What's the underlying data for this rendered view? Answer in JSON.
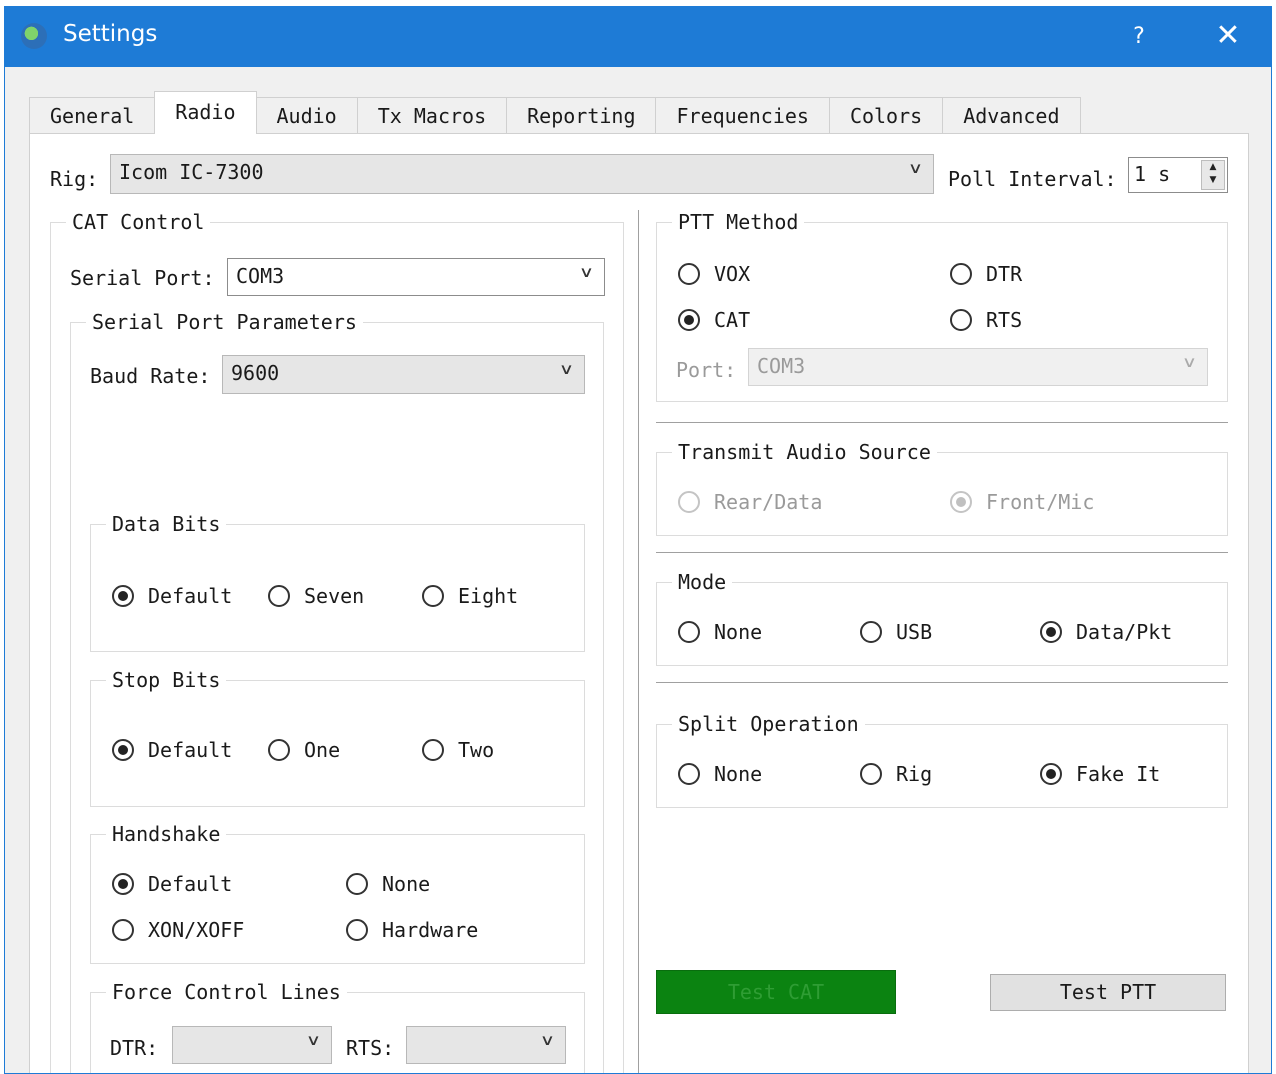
{
  "window": {
    "title": "Settings",
    "help": "?",
    "close": "✕"
  },
  "tabs": [
    {
      "label": "General",
      "active": false
    },
    {
      "label": "Radio",
      "active": true
    },
    {
      "label": "Audio",
      "active": false
    },
    {
      "label": "Tx Macros",
      "active": false
    },
    {
      "label": "Reporting",
      "active": false
    },
    {
      "label": "Frequencies",
      "active": false
    },
    {
      "label": "Colors",
      "active": false
    },
    {
      "label": "Advanced",
      "active": false
    }
  ],
  "rig": {
    "label": "Rig:",
    "value": "Icom IC-7300",
    "poll_label": "Poll Interval:",
    "poll_value": "1 s"
  },
  "cat": {
    "title": "CAT Control",
    "serial_port_label": "Serial Port:",
    "serial_port_value": "COM3",
    "params_title": "Serial Port Parameters",
    "baud_label": "Baud Rate:",
    "baud_value": "9600",
    "data_bits": {
      "title": "Data Bits",
      "options": [
        "Default",
        "Seven",
        "Eight"
      ],
      "selected": "Default"
    },
    "stop_bits": {
      "title": "Stop Bits",
      "options": [
        "Default",
        "One",
        "Two"
      ],
      "selected": "Default"
    },
    "handshake": {
      "title": "Handshake",
      "options": [
        "Default",
        "None",
        "XON/XOFF",
        "Hardware"
      ],
      "selected": "Default"
    },
    "force": {
      "title": "Force Control Lines",
      "dtr_label": "DTR:",
      "rts_label": "RTS:",
      "dtr_value": "",
      "rts_value": ""
    }
  },
  "ptt": {
    "title": "PTT Method",
    "options": [
      "VOX",
      "DTR",
      "CAT",
      "RTS"
    ],
    "selected": "CAT",
    "port_label": "Port:",
    "port_value": "COM3"
  },
  "tx_audio": {
    "title": "Transmit Audio Source",
    "options": [
      "Rear/Data",
      "Front/Mic"
    ],
    "selected": "Front/Mic"
  },
  "mode": {
    "title": "Mode",
    "options": [
      "None",
      "USB",
      "Data/Pkt"
    ],
    "selected": "Data/Pkt"
  },
  "split": {
    "title": "Split Operation",
    "options": [
      "None",
      "Rig",
      "Fake It"
    ],
    "selected": "Fake It"
  },
  "buttons": {
    "test_cat": "Test CAT",
    "test_ptt": "Test PTT"
  },
  "colors": {
    "titlebar": "#1e7bd6",
    "test_cat_bg": "#0b8311"
  }
}
